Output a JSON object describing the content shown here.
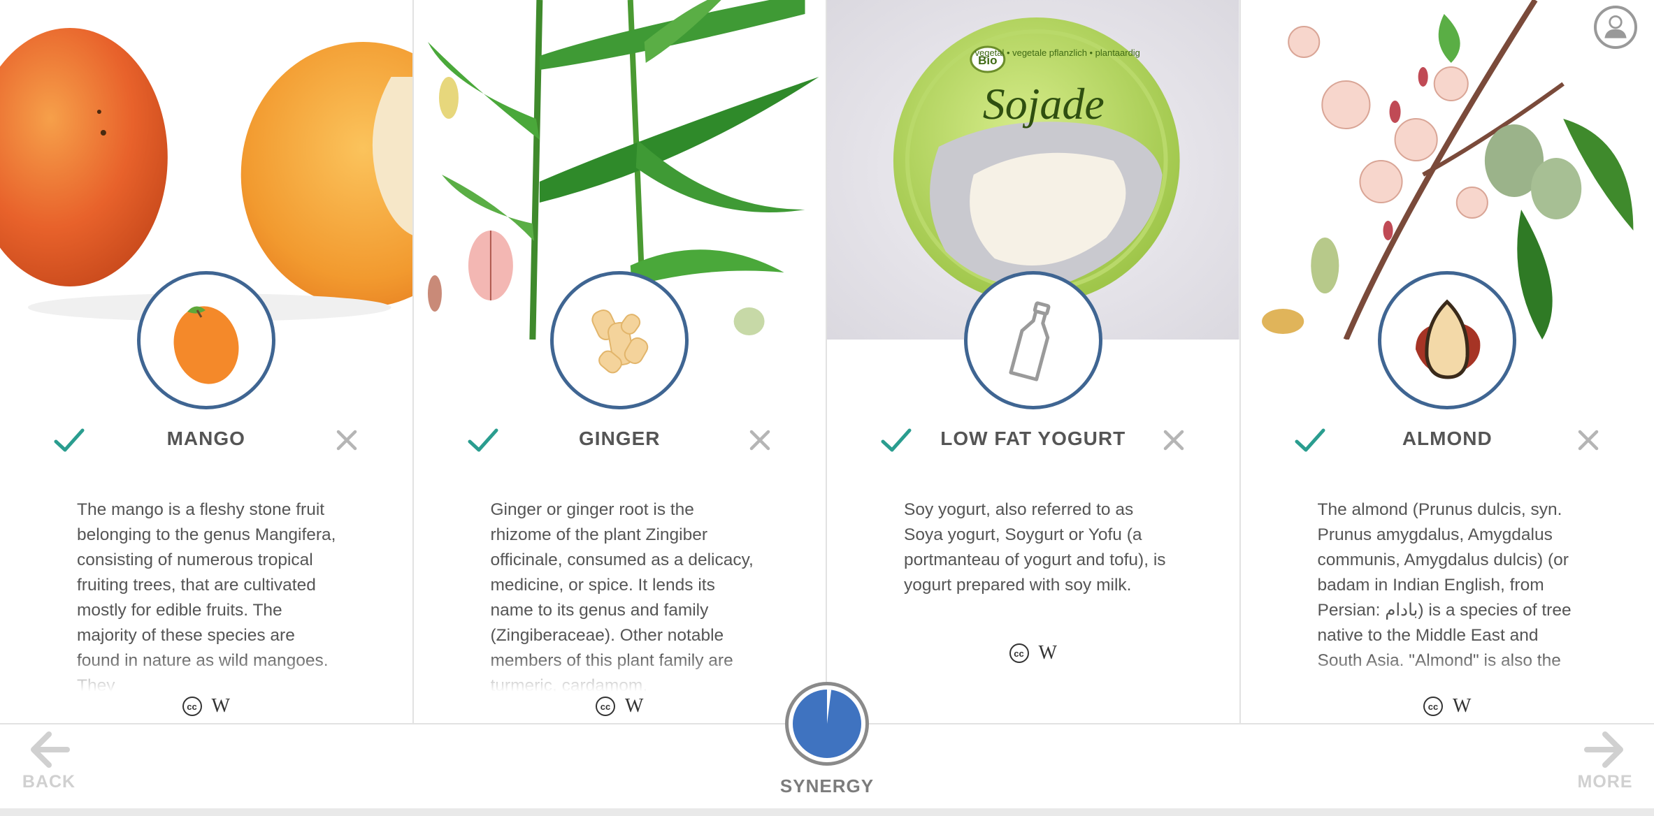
{
  "cards": [
    {
      "title": "MANGO",
      "description": "The mango is a fleshy stone fruit belonging to the genus Mangifera, consisting of numerous tropical fruiting trees, that are cultivated mostly for edible fruits. The majority of these species are found in nature as wild mangoes. They",
      "image": "mango-photo",
      "icon": "mango-icon"
    },
    {
      "title": "GINGER",
      "description": "Ginger or ginger root is the rhizome of the plant Zingiber officinale, consumed as a delicacy, medicine, or spice. It lends its name to its genus and family (Zingiberaceae). Other notable members of this plant family are turmeric, cardamom,",
      "image": "ginger-plant-illustration",
      "icon": "ginger-icon"
    },
    {
      "title": "LOW FAT YOGURT",
      "description": "Soy yogurt, also referred to as Soya yogurt, Soygurt or Yofu (a portmanteau of yogurt and tofu), is yogurt prepared with soy milk.",
      "image": "soy-yogurt-cup-photo",
      "image_text": {
        "brand": "Bio",
        "product": "Sojade",
        "sub": "vegetal • vegetale pflanzlich • plantaardig"
      },
      "icon": "milk-bottle-icon"
    },
    {
      "title": "ALMOND",
      "description": "The almond (Prunus dulcis, syn. Prunus amygdalus, Amygdalus communis, Amygdalus dulcis) (or badam in Indian English, from Persian: بادام) is a species of tree native to the Middle East and South Asia. \"Almond\" is also the",
      "image": "almond-plant-illustration",
      "icon": "almond-icon"
    }
  ],
  "attribution": {
    "cc": "cc",
    "wiki": "W"
  },
  "footer": {
    "back_label": "BACK",
    "more_label": "MORE",
    "synergy_label": "SYNERGY",
    "synergy_level": 0.02
  },
  "colors": {
    "accent_blue": "#3f6592",
    "synergy_blue": "#3f73c0",
    "check_teal": "#2a9d8f",
    "reject_gray": "#b5b5b5",
    "text": "#555555"
  }
}
